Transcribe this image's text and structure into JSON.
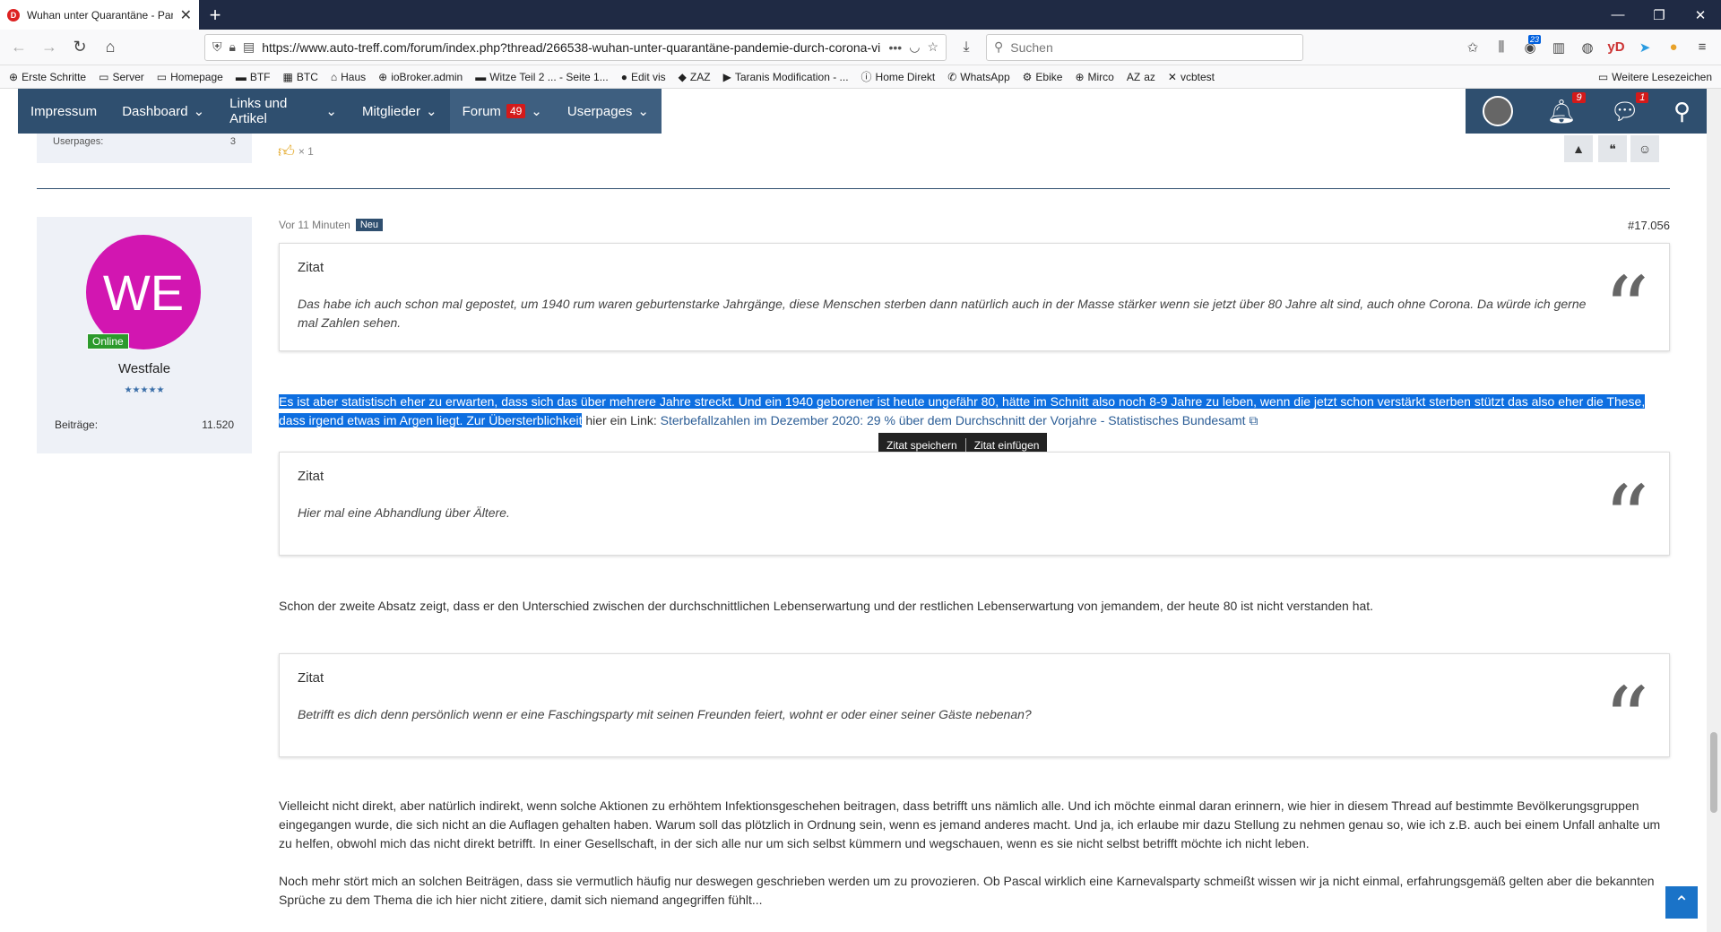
{
  "browser": {
    "tab_title": "Wuhan unter Quarantäne - Pan",
    "tab_favicon": "D",
    "url": "https://www.auto-treff.com/forum/index.php?thread/266538-wuhan-unter-quarantäne-pandemie-durch-corona-vi",
    "url_more": "•••",
    "search_placeholder": "Suchen",
    "library_badge": "23"
  },
  "bookmarks": [
    {
      "icon": "globe-icon",
      "glyph": "⊕",
      "label": "Erste Schritte"
    },
    {
      "icon": "folder-icon",
      "glyph": "▭",
      "label": "Server"
    },
    {
      "icon": "folder-icon",
      "glyph": "▭",
      "label": "Homepage"
    },
    {
      "icon": "btf-icon",
      "glyph": "▬",
      "label": "BTF"
    },
    {
      "icon": "btc-icon",
      "glyph": "▦",
      "label": "BTC"
    },
    {
      "icon": "haus-icon",
      "glyph": "⌂",
      "label": "Haus"
    },
    {
      "icon": "globe-icon",
      "glyph": "⊕",
      "label": "ioBroker.admin"
    },
    {
      "icon": "witze-icon",
      "glyph": "▬",
      "label": "Witze Teil 2 ... - Seite 1..."
    },
    {
      "icon": "edit-vis-icon",
      "glyph": "●",
      "label": "Edit vis"
    },
    {
      "icon": "zaz-icon",
      "glyph": "◆",
      "label": "ZAZ"
    },
    {
      "icon": "youtube-icon",
      "glyph": "▶",
      "label": "Taranis Modification - ..."
    },
    {
      "icon": "info-icon",
      "glyph": "ⓘ",
      "label": "Home Direkt"
    },
    {
      "icon": "whatsapp-icon",
      "glyph": "✆",
      "label": "WhatsApp"
    },
    {
      "icon": "ebike-icon",
      "glyph": "⚙",
      "label": "Ebike"
    },
    {
      "icon": "globe-icon",
      "glyph": "⊕",
      "label": "Mirco"
    },
    {
      "icon": "az-icon",
      "glyph": "AZ",
      "label": "az"
    },
    {
      "icon": "vcbtest-icon",
      "glyph": "✕",
      "label": "vcbtest"
    }
  ],
  "bookmarks_more": "Weitere Lesezeichen",
  "sitenav": {
    "items": [
      {
        "label": "Impressum",
        "chevron": ""
      },
      {
        "label": "Dashboard",
        "chevron": "⌄"
      },
      {
        "label": "Links und Artikel",
        "chevron": "⌄"
      },
      {
        "label": "Mitglieder",
        "chevron": "⌄"
      },
      {
        "label": "Forum",
        "chevron": "⌄",
        "count": "49"
      },
      {
        "label": "Userpages",
        "chevron": "⌄"
      }
    ],
    "notifications_count": "9",
    "conversations_count": "1"
  },
  "prev_post": {
    "userpages_label": "Userpages:",
    "userpages_value": "3",
    "reaction_count": "× 1"
  },
  "post": {
    "time": "Vor 11 Minuten",
    "new_badge": "Neu",
    "number": "#17.056",
    "user": {
      "initials": "WE",
      "avatar_color": "#d216b1",
      "online_label": "Online",
      "name": "Westfale",
      "stars": "★★★★★",
      "posts_label": "Beiträge:",
      "posts_value": "11.520"
    },
    "quote_label": "Zitat",
    "quote1": "Das habe ich auch schon mal gepostet, um 1940 rum waren geburtenstarke Jahrgänge, diese Menschen sterben dann natürlich auch in der Masse stärker wenn sie jetzt über 80 Jahre alt sind, auch ohne Corona. Da würde ich gerne mal Zahlen sehen.",
    "para1_selected": "Es ist aber statistisch eher zu erwarten, dass sich das über mehrere Jahre streckt. Und ein 1940 geborener ist heute ungefähr 80, hätte im Schnitt also noch 8-9 Jahre zu leben, wenn die jetzt schon verstärkt sterben stützt das also eher die These, dass irgend etwas im Argen liegt. Zur Übersterblichkeit",
    "para1_rest": " hier ein Link: ",
    "para1_link": "Sterbefallzahlen im Dezember 2020: 29 % über dem Durchschnitt der Vorjahre - Statistisches Bundesamt",
    "quote_popup_save": "Zitat speichern",
    "quote_popup_insert": "Zitat einfügen",
    "quote2": "Hier mal eine Abhandlung über Ältere.",
    "para2": "Schon der zweite Absatz zeigt, dass er den Unterschied zwischen der durchschnittlichen Lebenserwartung und der restlichen Lebenserwartung von jemandem, der heute 80 ist nicht verstanden hat.",
    "quote3": "Betrifft es dich denn persönlich wenn er eine Faschingsparty mit seinen Freunden feiert, wohnt er oder einer seiner Gäste nebenan?",
    "para3": "Vielleicht nicht direkt, aber natürlich indirekt, wenn solche Aktionen zu erhöhtem Infektionsgeschehen beitragen, dass betrifft uns nämlich alle. Und ich möchte einmal daran erinnern, wie hier in diesem Thread auf bestimmte Bevölkerungsgruppen eingegangen wurde, die sich nicht an die Auflagen gehalten haben. Warum soll das plötzlich in Ordnung sein, wenn es jemand anderes macht. Und ja, ich erlaube mir dazu Stellung zu nehmen genau so, wie ich z.B. auch bei einem Unfall anhalte um zu helfen, obwohl mich das nicht direkt betrifft. In einer Gesellschaft, in der sich alle nur um sich selbst kümmern und wegschauen, wenn es sie nicht selbst betrifft möchte ich nicht leben.",
    "para4": "Noch mehr stört mich an solchen Beiträgen, dass sie vermutlich häufig nur deswegen geschrieben werden um zu provozieren. Ob Pascal wirklich eine Karnevalsparty schmeißt wissen wir ja nicht einmal, erfahrungsgemäß gelten aber die bekannten Sprüche zu dem Thema die ich hier nicht zitiere, damit sich niemand angegriffen fühlt..."
  }
}
